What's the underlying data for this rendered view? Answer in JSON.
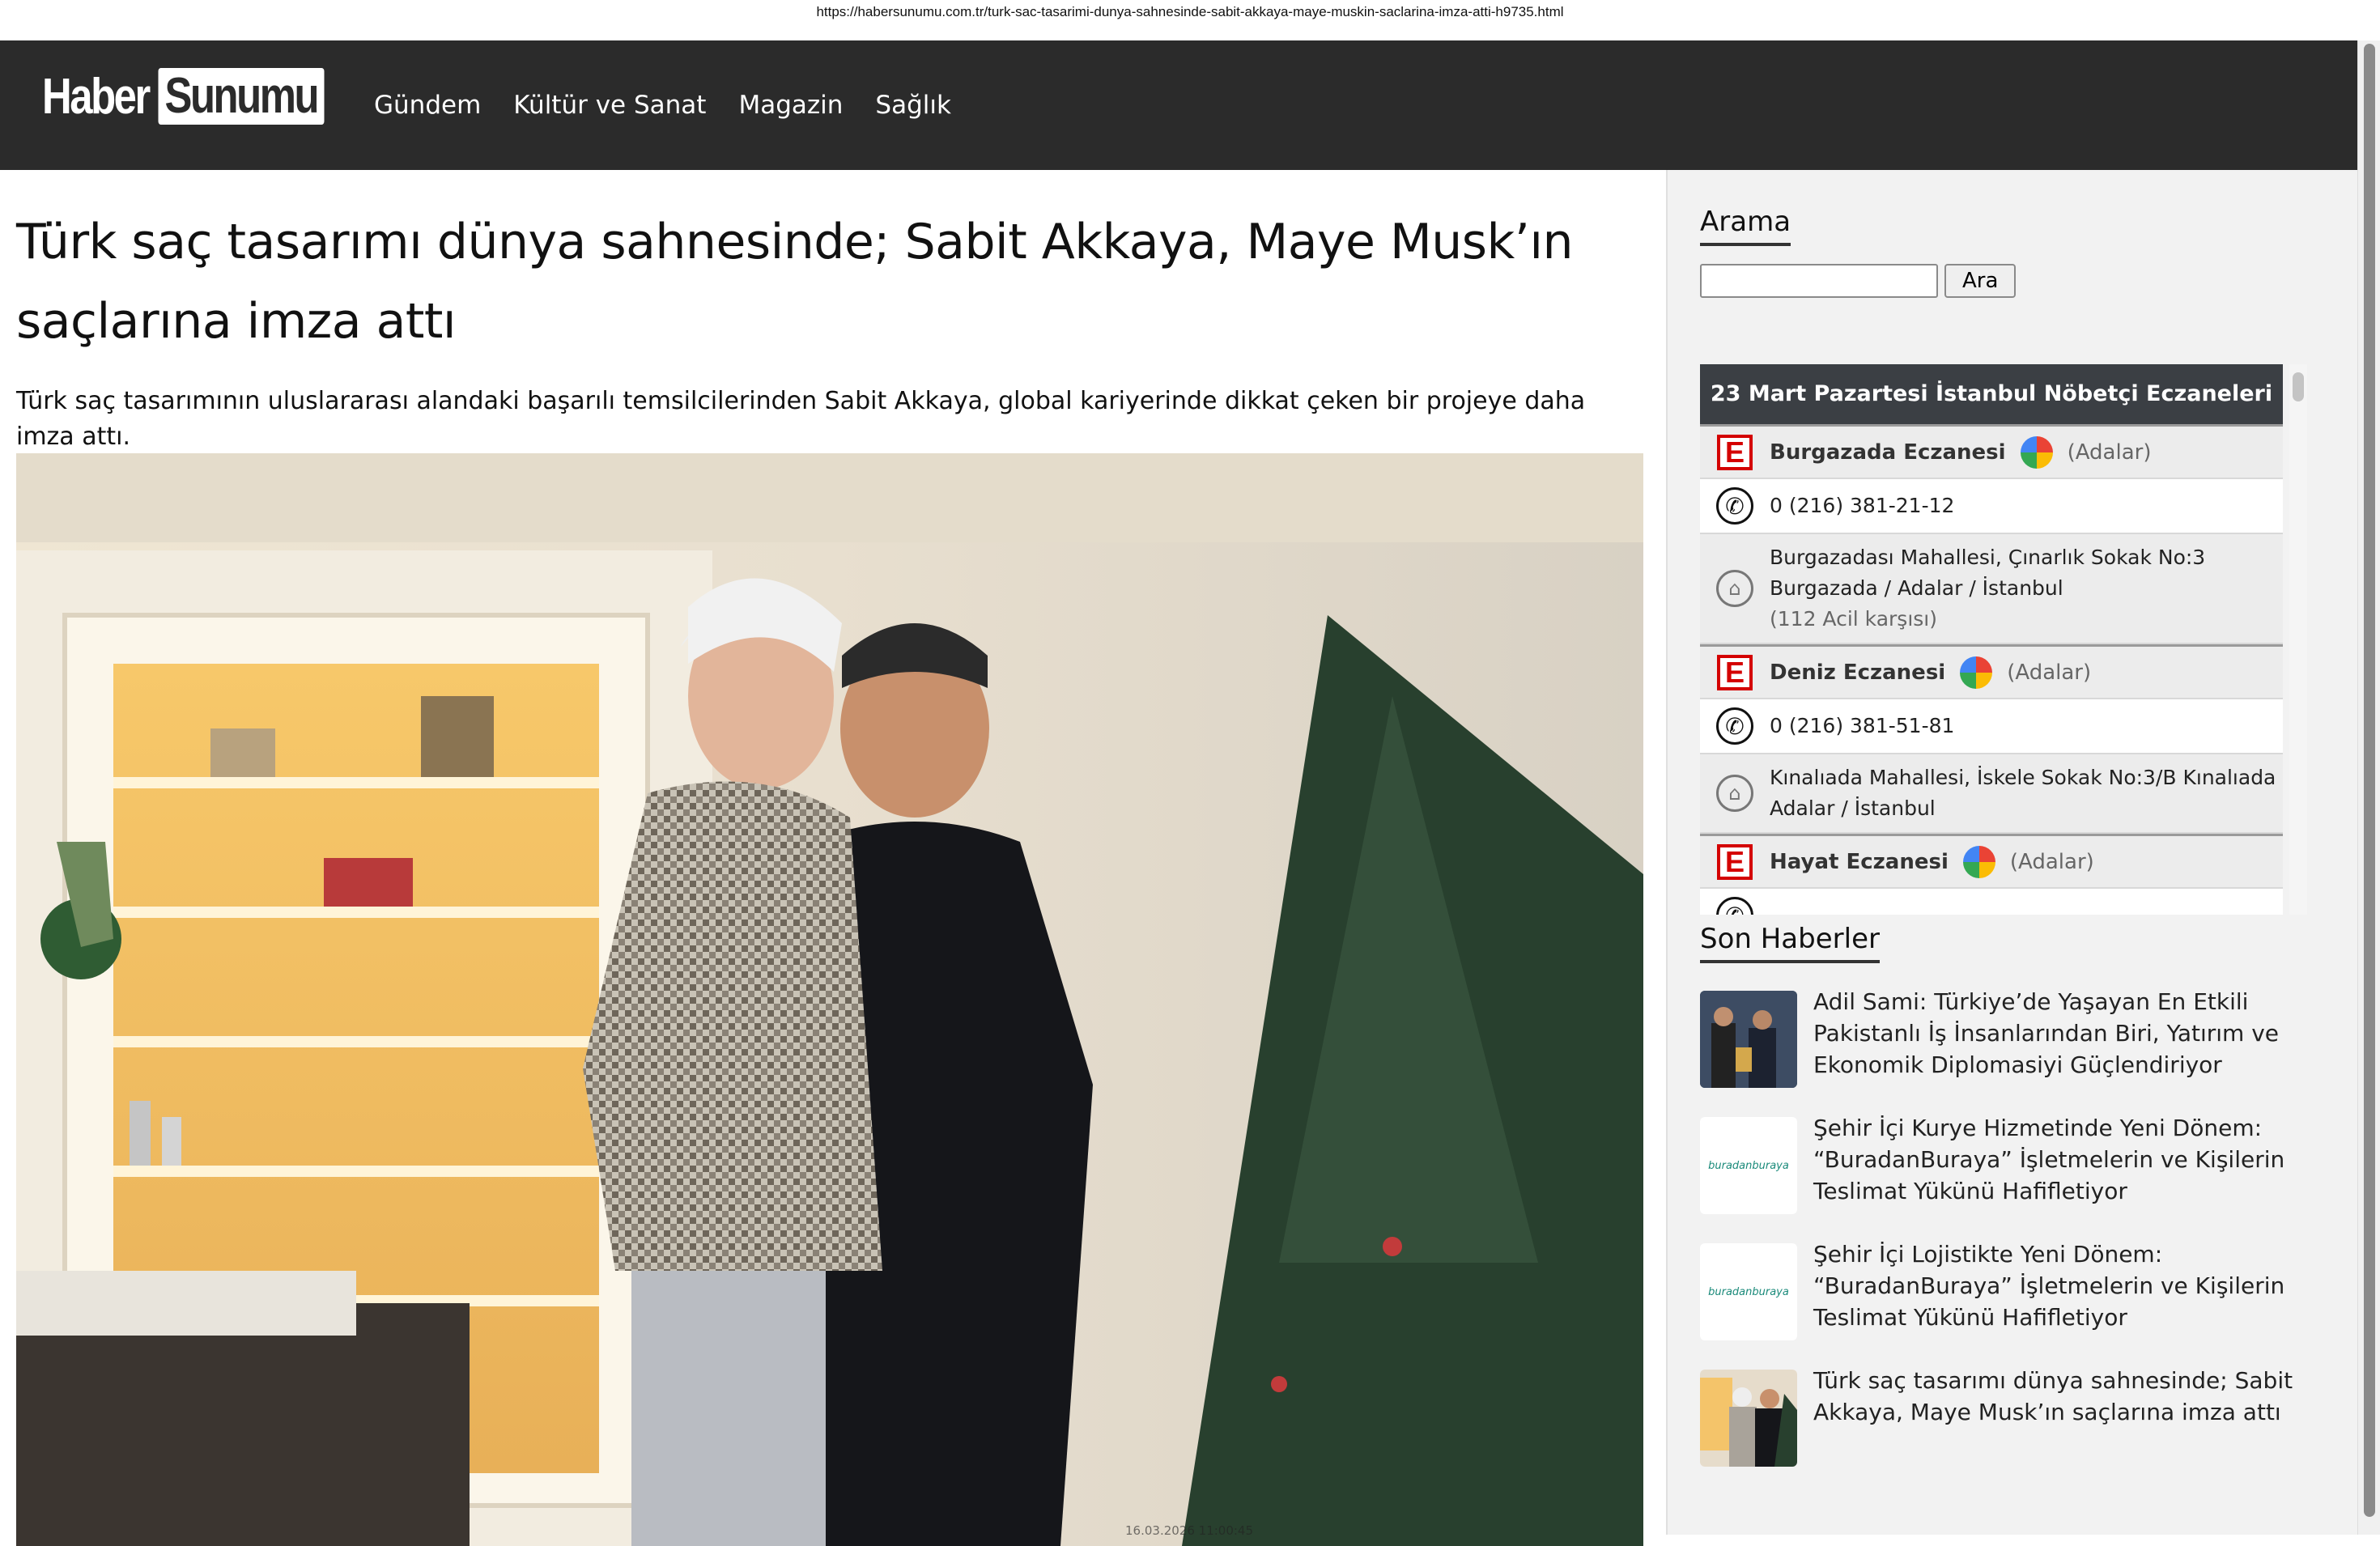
{
  "url": "https://habersunumu.com.tr/turk-sac-tasarimi-dunya-sahnesinde-sabit-akkaya-maye-muskin-saclarina-imza-atti-h9735.html",
  "header": {
    "logo_part1": "Haber",
    "logo_part2": "Sunumu",
    "nav": [
      "Gündem",
      "Kültür ve Sanat",
      "Magazin",
      "Sağlık"
    ]
  },
  "article": {
    "title": "Türk saç tasarımı dünya sahnesinde; Sabit Akkaya, Maye Musk’ın saçlarına imza attı",
    "summary": "Türk saç tasarımının uluslararası alandaki başarılı temsilcilerinden Sabit Akkaya, global kariyerinde dikkat çeken bir projeye daha imza attı.",
    "photo_timestamp": "16.03.2026 11:00:45"
  },
  "sidebar": {
    "search_title": "Arama",
    "search_button": "Ara",
    "pharmacy": {
      "header": "23 Mart Pazartesi İstanbul Nöbetçi Eczaneleri",
      "items": [
        {
          "name": "Burgazada Eczanesi",
          "district": "(Adalar)",
          "phone": "0 (216) 381-21-12",
          "address_lines": [
            "Burgazadası Mahallesi, Çınarlık Sokak No:3",
            "Burgazada / Adalar / İstanbul"
          ],
          "note": "(112 Acil karşısı)"
        },
        {
          "name": "Deniz Eczanesi",
          "district": "(Adalar)",
          "phone": "0 (216) 381-51-81",
          "address_lines": [
            "Kınalıada Mahallesi, İskele Sokak No:3/B Kınalıada",
            "Adalar / İstanbul"
          ],
          "note": ""
        },
        {
          "name": "Hayat Eczanesi",
          "district": "(Adalar)"
        }
      ]
    },
    "news_title": "Son Haberler",
    "news": [
      {
        "title": "Adil Sami: Türkiye’de Yaşayan En Etkili Pakistanlı İş İnsanlarından Biri, Yatırım ve Ekonomik Diplomasiyi Güçlendiriyor"
      },
      {
        "title": "Şehir İçi Kurye Hizmetinde Yeni Dönem: “BuradanBuraya” İşletmelerin ve Kişilerin Teslimat Yükünü Hafifletiyor",
        "thumb_text": "buradanburaya"
      },
      {
        "title": "Şehir İçi Lojistikte Yeni Dönem: “BuradanBuraya” İşletmelerin ve Kişilerin Teslimat Yükünü Hafifletiyor",
        "thumb_text": "buradanburaya"
      },
      {
        "title": "Türk saç tasarımı dünya sahnesinde; Sabit Akkaya, Maye Musk’ın saçlarına imza attı"
      }
    ]
  }
}
